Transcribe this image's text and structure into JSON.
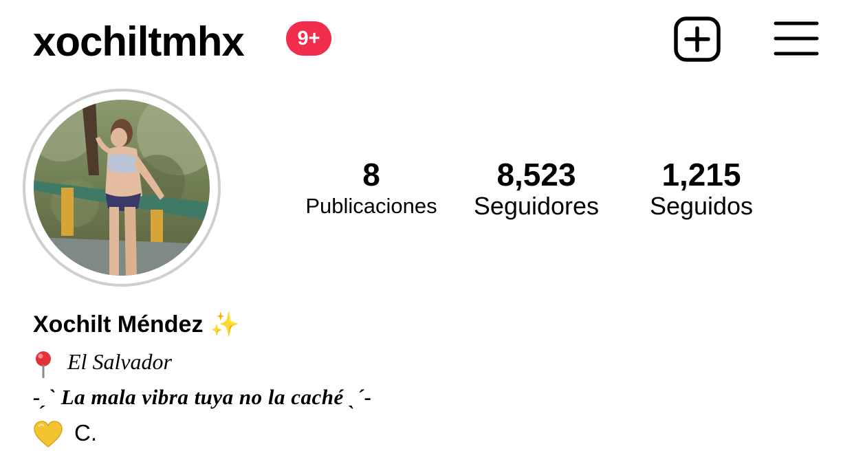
{
  "header": {
    "username": "xochiltmhx",
    "notification_badge": "9+",
    "badge_color": "#f02d4c",
    "new_post_icon": "plus-square-icon",
    "menu_icon": "hamburger-menu-icon"
  },
  "profile": {
    "avatar_icon": "profile-avatar",
    "stats": {
      "posts": {
        "value": "8",
        "label": "Publicaciones"
      },
      "followers": {
        "value": "8,523",
        "label": "Seguidores"
      },
      "following": {
        "value": "1,215",
        "label": "Seguidos"
      }
    }
  },
  "bio": {
    "full_name": "Xochilt Méndez",
    "name_emoji": "✨",
    "location_icon": "pushpin-icon",
    "location": "El Salvador",
    "quote": "-ˏˋ La mala vibra tuya no la caché ˎˊ-",
    "heart_icon": "yellow-heart-icon",
    "signature": "C."
  }
}
